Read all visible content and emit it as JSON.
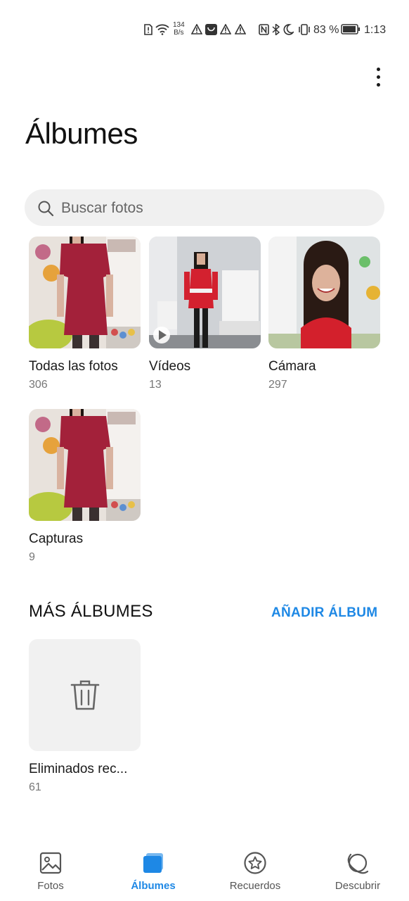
{
  "status_bar": {
    "net_speed_value": "134",
    "net_speed_unit": "B/s",
    "battery_percent": "83 %",
    "time": "1:13"
  },
  "header": {
    "title": "Álbumes"
  },
  "search": {
    "placeholder": "Buscar fotos"
  },
  "albums": [
    {
      "name": "Todas las fotos",
      "count": "306"
    },
    {
      "name": "Vídeos",
      "count": "13"
    },
    {
      "name": "Cámara",
      "count": "297"
    },
    {
      "name": "Capturas",
      "count": "9"
    }
  ],
  "more_albums": {
    "title": "MÁS ÁLBUMES",
    "add_label": "AÑADIR ÁLBUM",
    "items": [
      {
        "name": "Eliminados rec...",
        "count": "61"
      }
    ]
  },
  "bottom_nav": {
    "items": [
      {
        "label": "Fotos",
        "icon": "photo-icon"
      },
      {
        "label": "Álbumes",
        "icon": "albums-icon"
      },
      {
        "label": "Recuerdos",
        "icon": "star-icon"
      },
      {
        "label": "Descubrir",
        "icon": "discover-icon"
      }
    ],
    "active": "Álbumes"
  },
  "colors": {
    "accent": "#1e88e5",
    "dress": "#a3213a"
  }
}
